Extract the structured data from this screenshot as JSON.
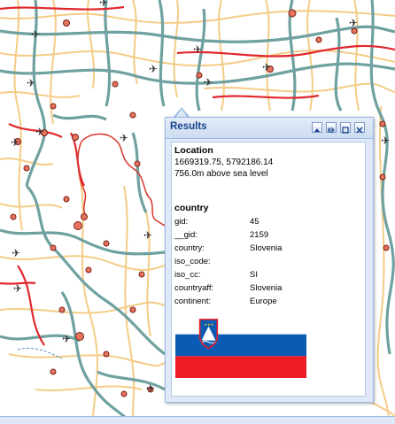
{
  "results": {
    "title": "Results",
    "location_heading": "Location",
    "coordinates": "1669319.75, 5792186.14",
    "elevation": "756.0m above sea level",
    "layer_heading": "country",
    "attributes": [
      {
        "key": "gid:",
        "value": "45"
      },
      {
        "key": "__gid:",
        "value": "2159"
      },
      {
        "key": "country:",
        "value": "Slovenia"
      },
      {
        "key": "iso_code:",
        "value": ""
      },
      {
        "key": "iso_cc:",
        "value": "SI"
      },
      {
        "key": "countryaff:",
        "value": "Slovenia"
      },
      {
        "key": "continent:",
        "value": "Europe"
      }
    ],
    "flag": {
      "country": "Slovenia",
      "colors": [
        "#ffffff",
        "#0b5bb5",
        "#ee1c25"
      ]
    }
  },
  "map": {
    "colors": {
      "land": "#ffffff",
      "sea_edge": "#d9342b",
      "motorway": "#6ea1a0",
      "main_road": "#e0272e",
      "minor_road": "#f4cc85",
      "city_dot": "#e6735e",
      "airport_icon": "#333333"
    },
    "icons": [
      "airport-icon",
      "city-marker"
    ]
  },
  "panel_colors": {
    "header_text": "#15428b",
    "border": "#99bbe8",
    "background": "#dfe8f6"
  }
}
